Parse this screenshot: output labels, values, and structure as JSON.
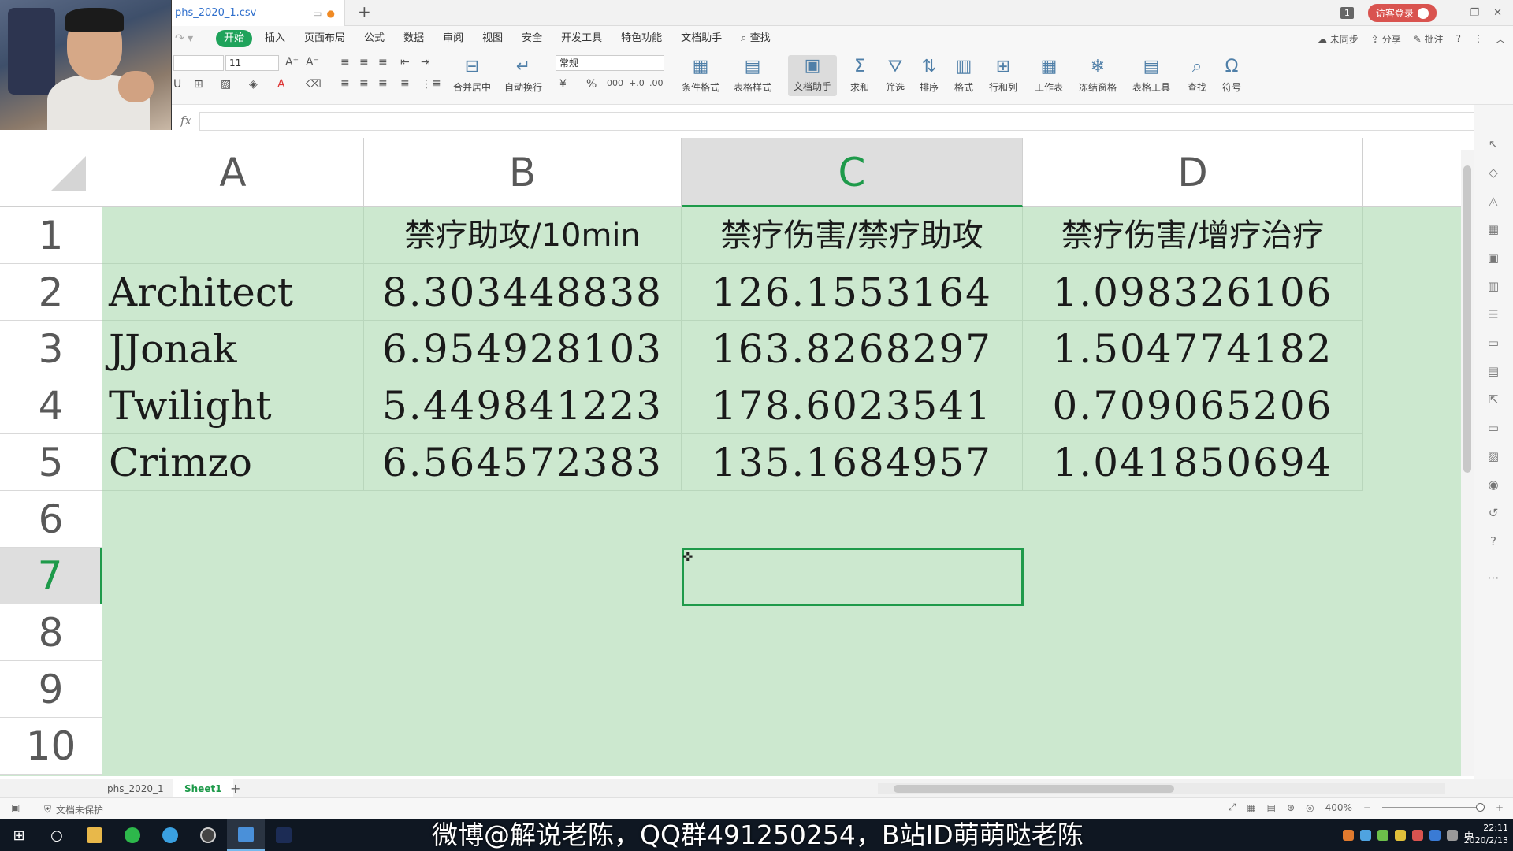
{
  "titlebar": {
    "doc_tab_title": "phs_2020_1.csv",
    "new_tab_icon": "plus-icon",
    "badge_count": "1",
    "login_label": "访客登录"
  },
  "menubar": {
    "items": [
      "开始",
      "插入",
      "页面布局",
      "公式",
      "数据",
      "审阅",
      "视图",
      "安全",
      "开发工具",
      "特色功能",
      "文档助手"
    ],
    "search_label": "查找",
    "right": [
      "未同步",
      "分享",
      "批注"
    ]
  },
  "ribbon": {
    "font_size": "11",
    "number_format": "常规",
    "buttons": [
      "合并居中",
      "自动换行",
      "条件格式",
      "表格样式",
      "文档助手",
      "求和",
      "筛选",
      "排序",
      "格式",
      "行和列",
      "工作表",
      "冻结窗格",
      "表格工具",
      "查找",
      "符号"
    ]
  },
  "formula_bar": {
    "fx_label": "fx",
    "value": ""
  },
  "sheet": {
    "columns": [
      "A",
      "B",
      "C",
      "D"
    ],
    "selected_column": "C",
    "rows": [
      "1",
      "2",
      "3",
      "4",
      "5",
      "6",
      "7",
      "8",
      "9",
      "10"
    ],
    "selected_row": "7",
    "selected_cell": "C7",
    "header_row": [
      "",
      "禁疗助攻/10min",
      "禁疗伤害/禁疗助攻",
      "禁疗伤害/增疗治疗"
    ],
    "data_rows": [
      [
        "Architect",
        "8.303448838",
        "126.1553164",
        "1.098326106"
      ],
      [
        "JJonak",
        "6.954928103",
        "163.8268297",
        "1.504774182"
      ],
      [
        "Twilight",
        "5.449841223",
        "178.6023541",
        "0.709065206"
      ],
      [
        "Crimzo",
        "6.564572383",
        "135.1684957",
        "1.041850694"
      ]
    ]
  },
  "sheet_tabs": {
    "tabs": [
      "phs_2020_1",
      "Sheet1"
    ],
    "active": "Sheet1"
  },
  "statusbar": {
    "protect_label": "文档未保护",
    "zoom": "400%"
  },
  "taskbar": {
    "overlay_text": "微博@解说老陈，QQ群491250254，B站ID萌萌哒老陈",
    "ime": "中",
    "time": "22:11",
    "date": "2020/2/13"
  },
  "colors": {
    "accent": "#1e9a4a",
    "cell_bg": "#cce8cf",
    "login_bg": "#d9534f"
  }
}
